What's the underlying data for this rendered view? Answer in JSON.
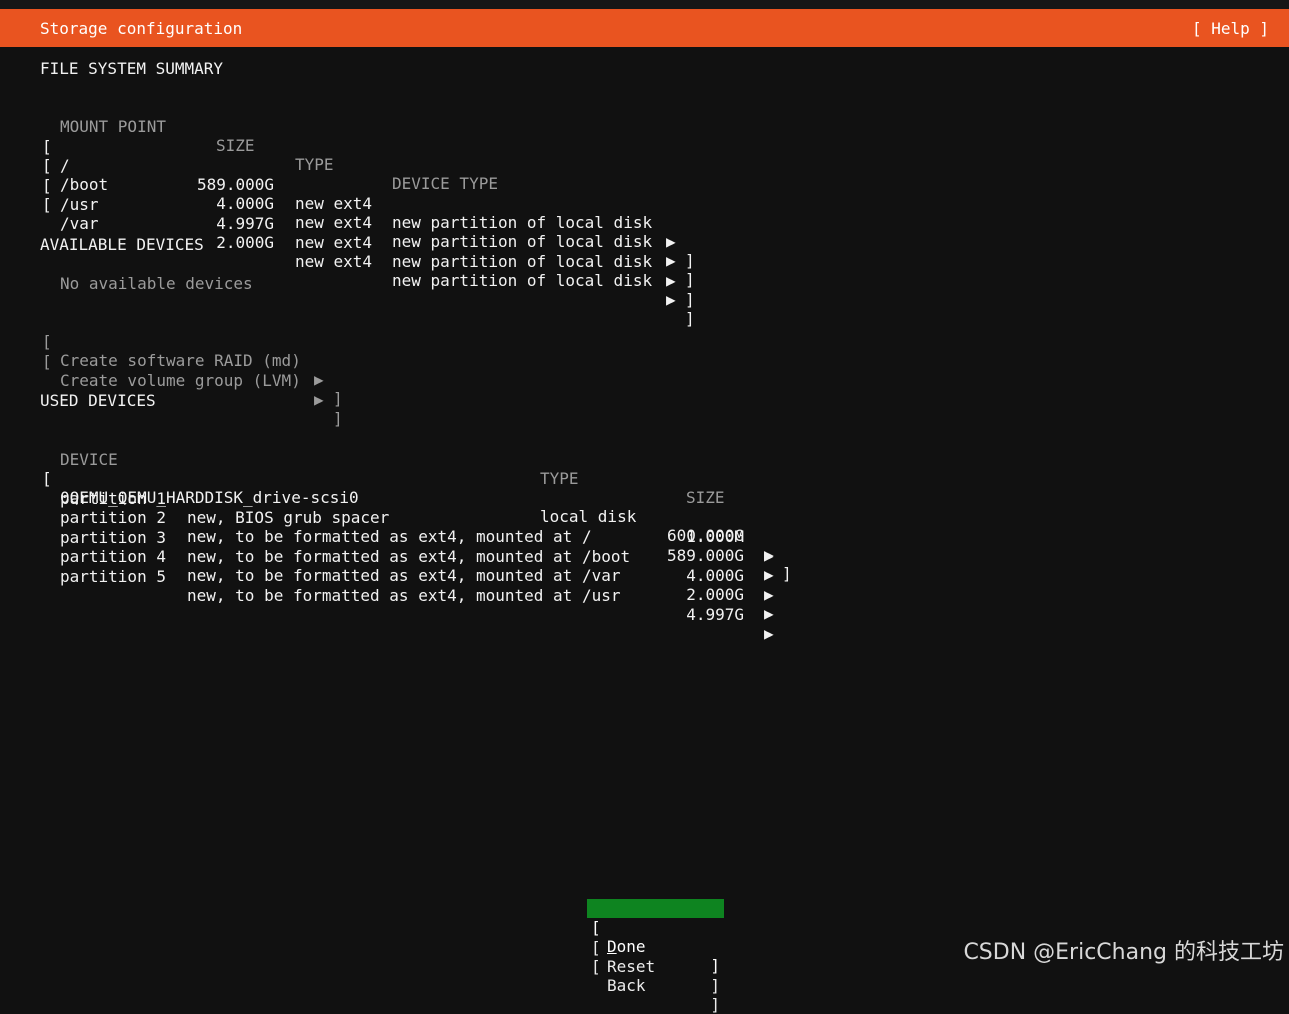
{
  "header": {
    "title": "Storage configuration",
    "help": "[ Help ]"
  },
  "fs_summary": {
    "heading": "FILE SYSTEM SUMMARY",
    "columns": {
      "mount": "MOUNT POINT",
      "size": "SIZE",
      "type": "TYPE",
      "device_type": "DEVICE TYPE"
    },
    "rows": [
      {
        "mount": "/",
        "size": "589.000G",
        "type": "new ext4",
        "device_type": "new partition of local disk"
      },
      {
        "mount": "/boot",
        "size": "4.000G",
        "type": "new ext4",
        "device_type": "new partition of local disk"
      },
      {
        "mount": "/usr",
        "size": "4.997G",
        "type": "new ext4",
        "device_type": "new partition of local disk"
      },
      {
        "mount": "/var",
        "size": "2.000G",
        "type": "new ext4",
        "device_type": "new partition of local disk"
      }
    ]
  },
  "available": {
    "heading": "AVAILABLE DEVICES",
    "empty": "No available devices",
    "actions": [
      "Create software RAID (md)",
      "Create volume group (LVM)"
    ]
  },
  "used": {
    "heading": "USED DEVICES",
    "columns": {
      "device": "DEVICE",
      "type": "TYPE",
      "size": "SIZE"
    },
    "disk": {
      "device": "0QEMU_QEMU_HARDDISK_drive-scsi0",
      "type": "local disk",
      "size": "600.000G"
    },
    "partitions": [
      {
        "name": "partition 1",
        "desc": "new, BIOS grub spacer",
        "size": "1.000M"
      },
      {
        "name": "partition 2",
        "desc": "new, to be formatted as ext4, mounted at /",
        "size": "589.000G"
      },
      {
        "name": "partition 3",
        "desc": "new, to be formatted as ext4, mounted at /boot",
        "size": "4.000G"
      },
      {
        "name": "partition 4",
        "desc": "new, to be formatted as ext4, mounted at /var",
        "size": "2.000G"
      },
      {
        "name": "partition 5",
        "desc": "new, to be formatted as ext4, mounted at /usr",
        "size": "4.997G"
      }
    ]
  },
  "buttons": [
    {
      "first": "D",
      "rest": "one"
    },
    {
      "first": "R",
      "rest": "eset"
    },
    {
      "first": "B",
      "rest": "ack"
    }
  ],
  "glyphs": {
    "open": "[",
    "close": "]",
    "arrow": "▶"
  },
  "watermark": "CSDN @EricChang 的科技工坊",
  "colors": {
    "accent": "#e95420",
    "selected": "#0e8420",
    "background": "#111111"
  }
}
